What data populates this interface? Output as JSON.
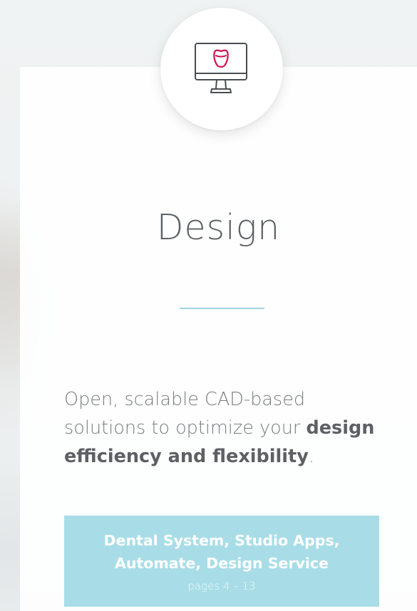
{
  "section": {
    "icon": "monitor-tooth-icon",
    "title": "Design",
    "intro_plain": "Open, scalable CAD-based solutions to optimize your ",
    "intro_bold": "design efficiency and flexibility",
    "intro_end": "."
  },
  "cta": {
    "title_line1": "Dental System, Studio Apps,",
    "title_line2": "Automate, Design Service",
    "pages": "pages 4 – 13"
  },
  "colors": {
    "accent": "#a8dde7",
    "divider": "#9fd4de",
    "tooth_icon": "#d0124a",
    "text": "#5e6164"
  }
}
